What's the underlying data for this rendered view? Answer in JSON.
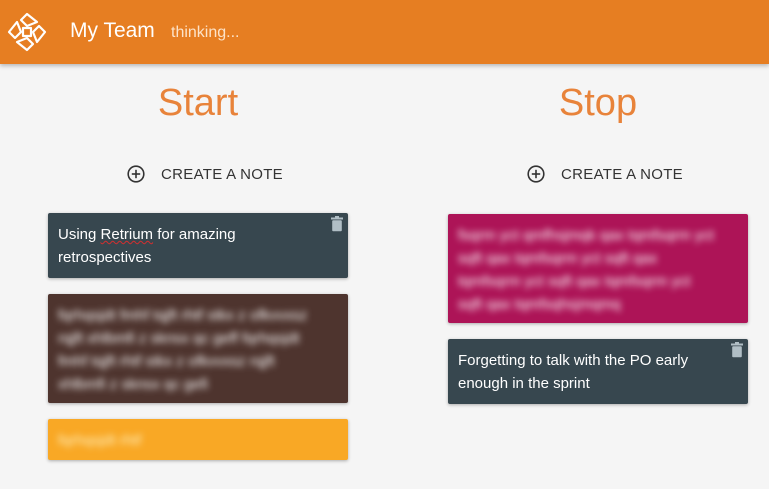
{
  "header": {
    "team_name": "My Team",
    "status": "thinking...",
    "brand_color": "#e67e22"
  },
  "columns": [
    {
      "title": "Start",
      "create_label": "CREATE A NOTE",
      "notes": [
        {
          "text_a": "Using ",
          "text_b": "Retrium",
          "text_c": " for amazing retrospectives",
          "color": "#37474f"
        },
        {
          "text": "fqrhqsjdt fmhf tqjft rhtf stkx z ofkvvxsz rqjft xhlbmfi z sknsx qc geff fqrhqsjdt fmhf tqjft rhtf stkx z ofkvvxsz rqjft xhlbmfi z sknsx qc gefi",
          "color": "#4e342e"
        },
        {
          "text": "fqrhqsjdt rhtf",
          "color": "#f9a825"
        }
      ]
    },
    {
      "title": "Stop",
      "create_label": "CREATE A NOTE",
      "notes": [
        {
          "text": "fsqrm yct qmfhsjmqk qax tqmfsqrm yct sqft qax tqmfsqrm yct sqft qax tqmfsqrm yct sqft qax tqmfsqrm yct sqft qax tqmfsqhsjmqmq",
          "color": "#ad1457"
        },
        {
          "text": "Forgetting to talk with the PO early enough in the sprint",
          "color": "#37474f"
        }
      ]
    }
  ]
}
